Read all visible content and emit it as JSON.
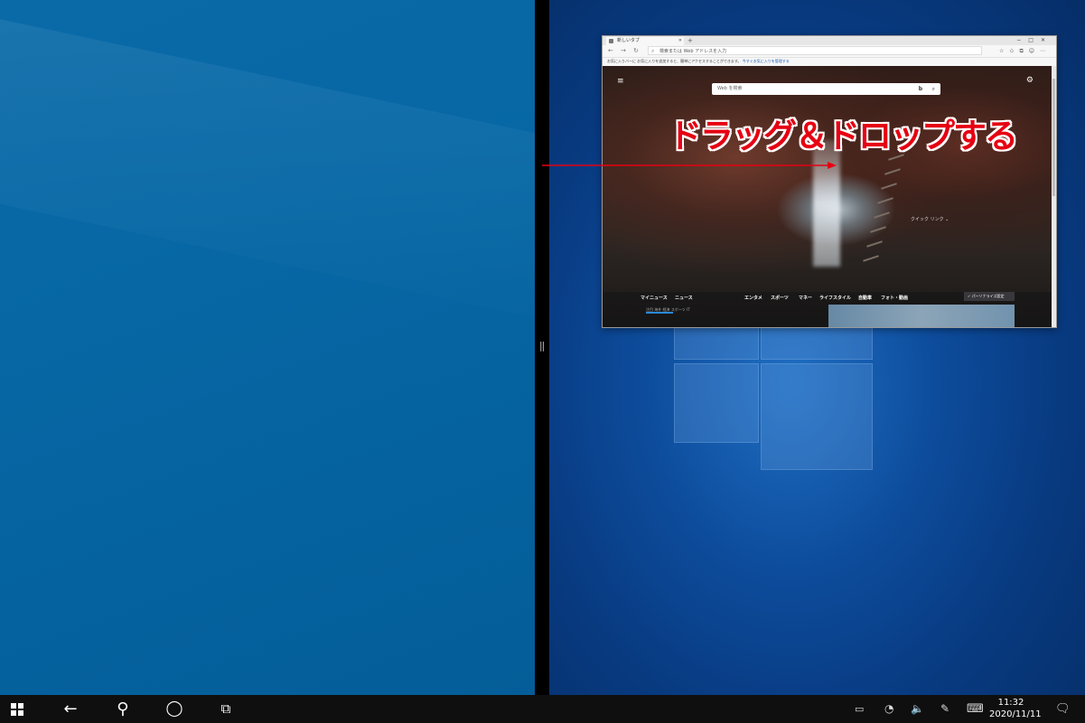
{
  "annotation": {
    "text": "ドラッグ＆ドロップする",
    "color": "#e60012"
  },
  "browser": {
    "tab_title": "新しいタブ",
    "address_placeholder": "検索または Web アドレスを入力",
    "favorites_bar_text": "お気に入りバーに お気に入りを追加すると、簡単にアクセスすることができます。",
    "favorites_bar_link": "今すぐお気に入りを管理する",
    "web_search_placeholder": "Web を検索",
    "quick_links_label": "クイック リンク",
    "news_nav": [
      "マイニュース",
      "ニュース",
      "エンタメ",
      "スポーツ",
      "マネー",
      "ライフスタイル",
      "自動車",
      "フォト・動画"
    ],
    "personalize_label": "✓ パーソナライズ設定",
    "subnav_items": [
      "注目",
      "海外",
      "経済",
      "スポーツ",
      "IT"
    ]
  },
  "taskbar": {
    "time": "11:32",
    "date": "2020/11/11",
    "icons": [
      "windows-start-icon",
      "back-arrow-icon",
      "search-icon",
      "cortana-icon",
      "task-view-icon"
    ],
    "tray_icons": [
      "battery-icon",
      "wifi-icon",
      "volume-icon",
      "pen-icon",
      "keyboard-icon",
      "notification-icon"
    ]
  },
  "colors": {
    "left_wallpaper": "#0667a4",
    "right_wallpaper": "#0d4c9c",
    "taskbar": "#0f0f0f"
  }
}
